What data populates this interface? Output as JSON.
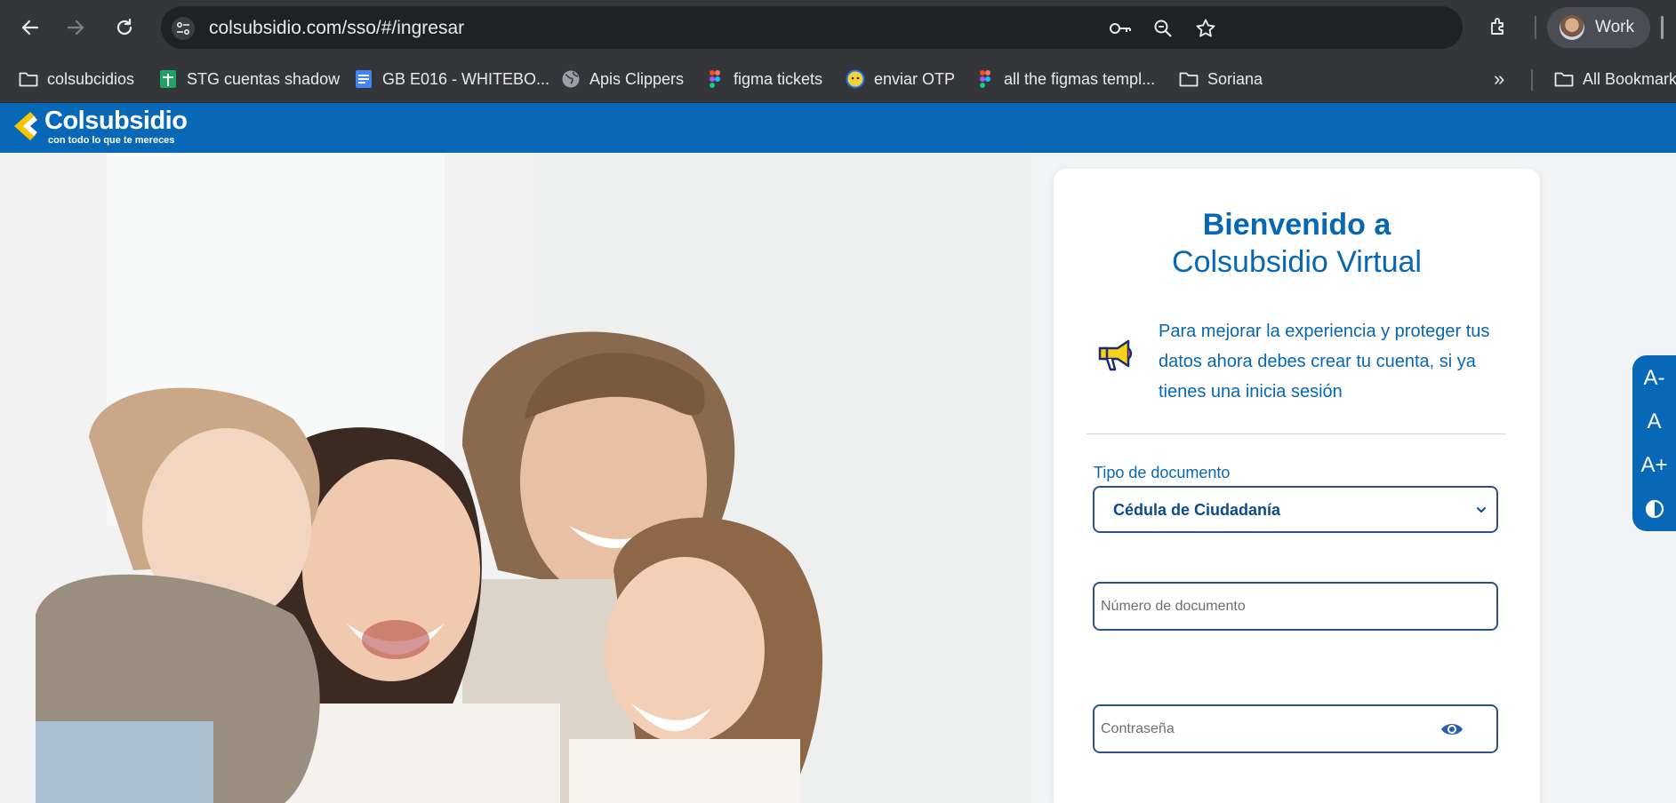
{
  "browser": {
    "url": "colsubsidio.com/sso/#/ingresar",
    "profile_label": "Work",
    "bookmarks": [
      {
        "label": "colsubcidios",
        "icon": "folder-icon"
      },
      {
        "label": "STG cuentas shadow",
        "icon": "sheets-icon"
      },
      {
        "label": "GB E016 - WHITEBO...",
        "icon": "docs-icon"
      },
      {
        "label": "Apis Clippers",
        "icon": "globe-icon"
      },
      {
        "label": "figma tickets",
        "icon": "figma-icon"
      },
      {
        "label": "enviar OTP",
        "icon": "chat-icon"
      },
      {
        "label": "all the figmas templ...",
        "icon": "figma-icon"
      },
      {
        "label": "Soriana",
        "icon": "folder-icon"
      }
    ],
    "more_bookmarks_label": "»",
    "all_bookmarks_label": "All Bookmarks"
  },
  "header": {
    "logo_text": "Colsubsidio",
    "logo_tagline": "con todo lo que te mereces",
    "brand_color": "#0768b7"
  },
  "login": {
    "title_line1": "Bienvenido a",
    "title_line2": "Colsubsidio Virtual",
    "notice": "Para mejorar la experiencia y proteger tus datos ahora debes crear tu cuenta, si ya tienes una inicia sesión",
    "doc_type_label": "Tipo de documento",
    "doc_type_value": "Cédula de Ciudadanía",
    "doc_number_placeholder": "Número de documento",
    "password_placeholder": "Contraseña"
  },
  "accessibility": {
    "decrease_label": "A-",
    "normal_label": "A",
    "increase_label": "A+",
    "contrast_icon": "contrast-icon"
  }
}
